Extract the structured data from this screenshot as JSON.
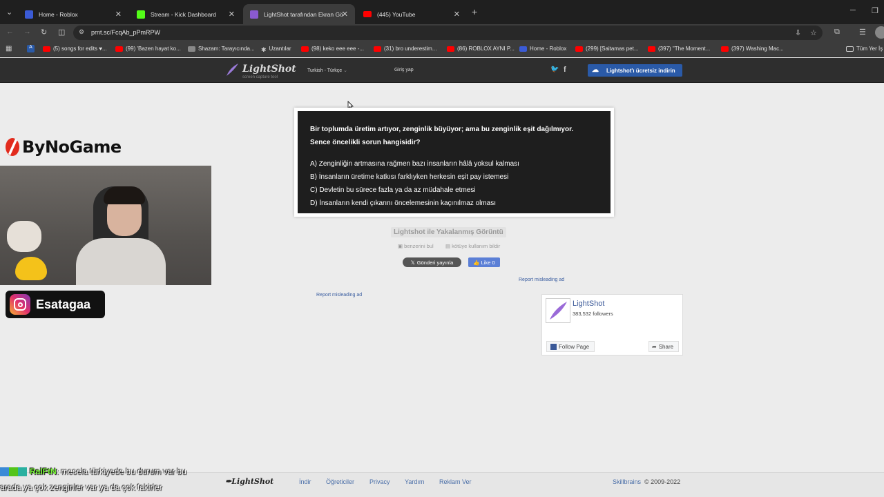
{
  "browser": {
    "tabs": [
      {
        "title": "Home - Roblox",
        "active": false,
        "color": "#3b5bd6"
      },
      {
        "title": "Stream - Kick Dashboard",
        "active": false,
        "color": "#53fc18"
      },
      {
        "title": "LightShot tarafından Ekran Görü",
        "active": true,
        "color": "#8a5ad0"
      },
      {
        "title": "(445) YouTube",
        "active": false,
        "color": "#ff0000"
      }
    ],
    "url": "prnt.sc/FcqAb_pPmRPW",
    "bookmarks": [
      "(5) songs for edits ♥...",
      "(99) 'Bazen hayat ko...",
      "Shazam: Tarayıcında...",
      "Uzantılar",
      "(98) keko eee eee -...",
      "(31) bro underestim...",
      "(86) ROBLOX AYNI P...",
      "Home - Roblox",
      "(299) [Saitamas pet...",
      "(397) \"The Moment...",
      "(397) Washing Mac..."
    ],
    "all_bookmarks": "Tüm Yer İş"
  },
  "lightshot": {
    "logo": "LightShot",
    "logo_sub": "screen capture tool",
    "language": "Turkish - Türkçe",
    "login": "Giriş yap",
    "download": "Lightshot'ı ücretsiz indirin",
    "question_line1": "Bir toplumda üretim artıyor, zenginlik büyüyor; ama bu zenginlik eşit dağılmıyor.",
    "question_line2": "Sence öncelikli sorun hangisidir?",
    "options": [
      "A) Zenginliğin artmasına rağmen bazı insanların hâlâ yoksul kalması",
      "B) İnsanların üretime katkısı farklıyken herkesin eşit pay istemesi",
      "C) Devletin bu sürece fazla ya da az müdahale etmesi",
      "D) İnsanların kendi çıkarını öncelemesinin kaçınılmaz olması"
    ],
    "captured_label": "Lightshot ile Yakalanmış Görüntü",
    "find_similar": "benzerini bul",
    "report_abuse": "kötüye kullanım bildir",
    "tweet": "Gönderi yayınla",
    "like": "Like 0",
    "report_ad_right": "Report misleading ad",
    "report_ad_left": "Report misleading ad",
    "fb_name": "LightShot",
    "fb_followers": "383,532 followers",
    "fb_follow": "Follow Page",
    "fb_share": "Share"
  },
  "footer": {
    "logo": "LightShot",
    "links": [
      "İndir",
      "Öğreticiler",
      "Privacy",
      "Yardım",
      "Reklam Ver"
    ],
    "brand": "Skillbrains",
    "copyright": "© 2009-2022"
  },
  "stream": {
    "channel": "ByNoGame",
    "instagram": "Esatagaa",
    "chat_user": "RalFtN",
    "chat_line1": ": mesela türkiyede bu durum var bu",
    "chat_line2": "arada ya çok zenginler var ya da çok fakirler"
  }
}
